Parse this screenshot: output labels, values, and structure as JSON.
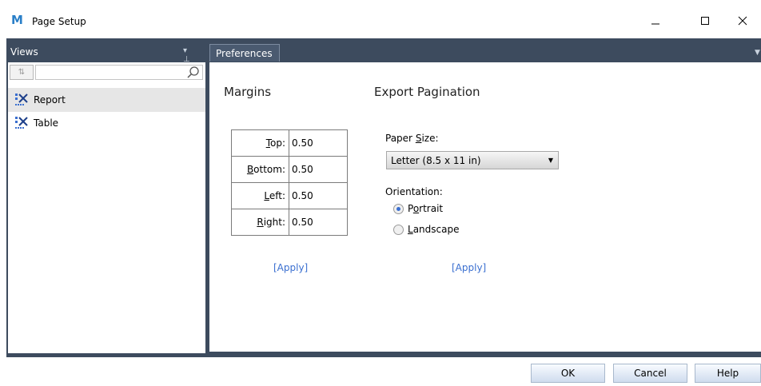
{
  "window": {
    "title": "Page Setup",
    "logo_glyph": "M",
    "accent_color": "#2a7fc8",
    "frame_color": "#3d4b5e"
  },
  "views_panel": {
    "header": "Views",
    "filter_placeholder": "",
    "filter_value": "",
    "sort_glyph": "⇅",
    "items": [
      {
        "label": "Report",
        "selected": true,
        "icon": "report-icon"
      },
      {
        "label": "Table",
        "selected": false,
        "icon": "table-icon"
      }
    ]
  },
  "preferences": {
    "tab_label": "Preferences",
    "margins": {
      "title": "Margins",
      "rows": [
        {
          "label_pre": "",
          "label_accel": "T",
          "label_post": "op:",
          "value": "0.50"
        },
        {
          "label_pre": "",
          "label_accel": "B",
          "label_post": "ottom:",
          "value": "0.50"
        },
        {
          "label_pre": "",
          "label_accel": "L",
          "label_post": "eft:",
          "value": "0.50"
        },
        {
          "label_pre": "",
          "label_accel": "R",
          "label_post": "ight:",
          "value": "0.50"
        }
      ],
      "apply": "[Apply]"
    },
    "export_pagination": {
      "title": "Export Pagination",
      "paper_size_pre": "Paper ",
      "paper_size_accel": "S",
      "paper_size_post": "ize:",
      "paper_size_value": "Letter (8.5 x 11 in)",
      "orientation_label": "Orientation:",
      "portrait_pre": "P",
      "portrait_accel": "o",
      "portrait_post": "rtrait",
      "landscape_accel": "L",
      "landscape_post": "andscape",
      "selected_orientation": "Portrait",
      "apply": "[Apply]"
    }
  },
  "footer": {
    "ok": "OK",
    "cancel": "Cancel",
    "help": "Help"
  }
}
